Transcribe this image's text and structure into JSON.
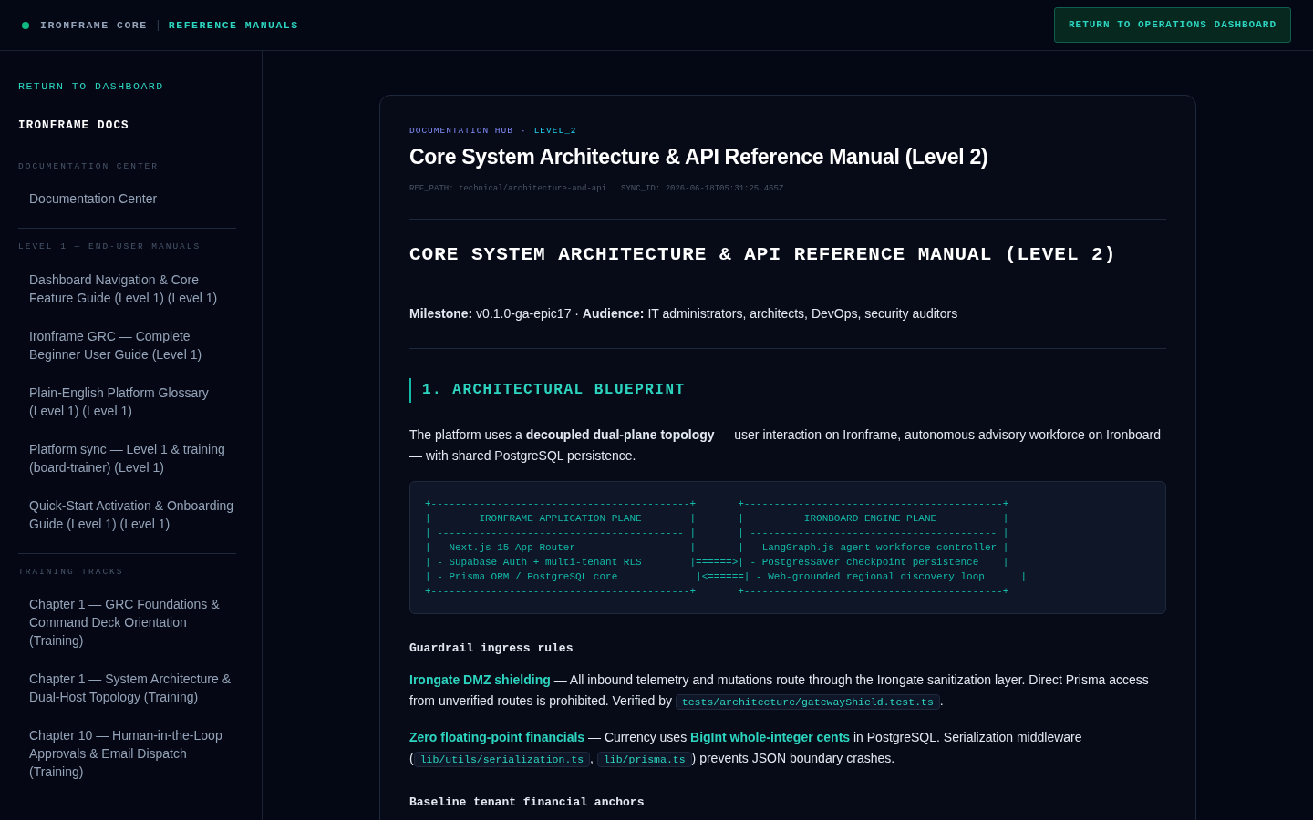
{
  "topbar": {
    "brand": "IRONFRAME CORE",
    "separator": "|",
    "section": "REFERENCE MANUALS",
    "button": "RETURN TO OPERATIONS DASHBOARD"
  },
  "sidebar": {
    "back_link": "RETURN TO DASHBOARD",
    "title": "IRONFRAME DOCS",
    "groups": [
      {
        "heading": "DOCUMENTATION CENTER",
        "items": [
          "Documentation Center"
        ]
      },
      {
        "heading": "LEVEL 1 — END-USER MANUALS",
        "items": [
          "Dashboard Navigation & Core Feature Guide (Level 1) (Level 1)",
          "Ironframe GRC — Complete Beginner User Guide (Level 1)",
          "Plain-English Platform Glossary (Level 1) (Level 1)",
          "Platform sync — Level 1 & training (board-trainer) (Level 1)",
          "Quick-Start Activation & Onboarding Guide (Level 1) (Level 1)"
        ]
      },
      {
        "heading": "TRAINING TRACKS",
        "items": [
          "Chapter 1 — GRC Foundations & Command Deck Orientation (Training)",
          "Chapter 1 — System Architecture & Dual-Host Topology (Training)",
          "Chapter 10 — Human-in-the-Loop Approvals & Email Dispatch (Training)"
        ]
      }
    ]
  },
  "doc": {
    "breadcrumb": [
      "DOCUMENTATION HUB",
      "·",
      "LEVEL_2"
    ],
    "title": "Core System Architecture & API Reference Manual (Level 2)",
    "ref_path": "REF_PATH: technical/architecture-and-api",
    "sync_id": "SYNC_ID: 2026-06-18T05:31:25.465Z",
    "heading": "CORE SYSTEM ARCHITECTURE & API REFERENCE MANUAL (LEVEL 2)",
    "meta": "**Milestone:** v0.1.0-ga-epic17 · **Audience:** IT administrators, architects, DevOps, security auditors",
    "section": "1. ARCHITECTURAL BLUEPRINT",
    "intro": "The platform uses a **decoupled dual-plane topology** — user interaction on Ironframe, autonomous advisory workforce on Ironboard — with shared PostgreSQL persistence.",
    "diagram": [
      "+-------------------------------------------+       +-------------------------------------------+",
      "|        IRONFRAME APPLICATION PLANE        |       |          IRONBOARD ENGINE PLANE           |",
      "| ----------------------------------------- |       | ----------------------------------------- |",
      "| - Next.js 15 App Router                   |       | - LangGraph.js agent workforce controller |",
      "| - Supabase Auth + multi-tenant RLS        |======>| - PostgresSaver checkpoint persistence    |",
      "| - Prisma ORM / PostgreSQL core             |<======| - Web-grounded regional discovery loop      |",
      "+-------------------------------------------+       +-------------------------------------------+"
    ],
    "subheading": "Guardrail ingress rules",
    "rules": [
      [
        {
          "kind": "strong",
          "text": "Irongate DMZ shielding"
        },
        {
          "kind": "text",
          "text": " — All inbound telemetry and mutations route through the Irongate sanitization layer. Direct Prisma access from unverified routes is prohibited. Verified by "
        },
        {
          "kind": "code",
          "text": "tests/architecture/gatewayShield.test.ts"
        },
        {
          "kind": "text",
          "text": "."
        }
      ],
      [
        {
          "kind": "strong",
          "text": "Zero floating-point financials"
        },
        {
          "kind": "text",
          "text": " — Currency uses "
        },
        {
          "kind": "strong",
          "text": "BigInt whole-integer cents"
        },
        {
          "kind": "text",
          "text": " in PostgreSQL. Serialization middleware ("
        },
        {
          "kind": "code",
          "text": "lib/utils/serialization.ts"
        },
        {
          "kind": "text",
          "text": ", "
        },
        {
          "kind": "code",
          "text": "lib/prisma.ts"
        },
        {
          "kind": "text",
          "text": ") prevents JSON boundary crashes."
        }
      ]
    ],
    "subheading_2": "Baseline tenant financial anchors"
  }
}
